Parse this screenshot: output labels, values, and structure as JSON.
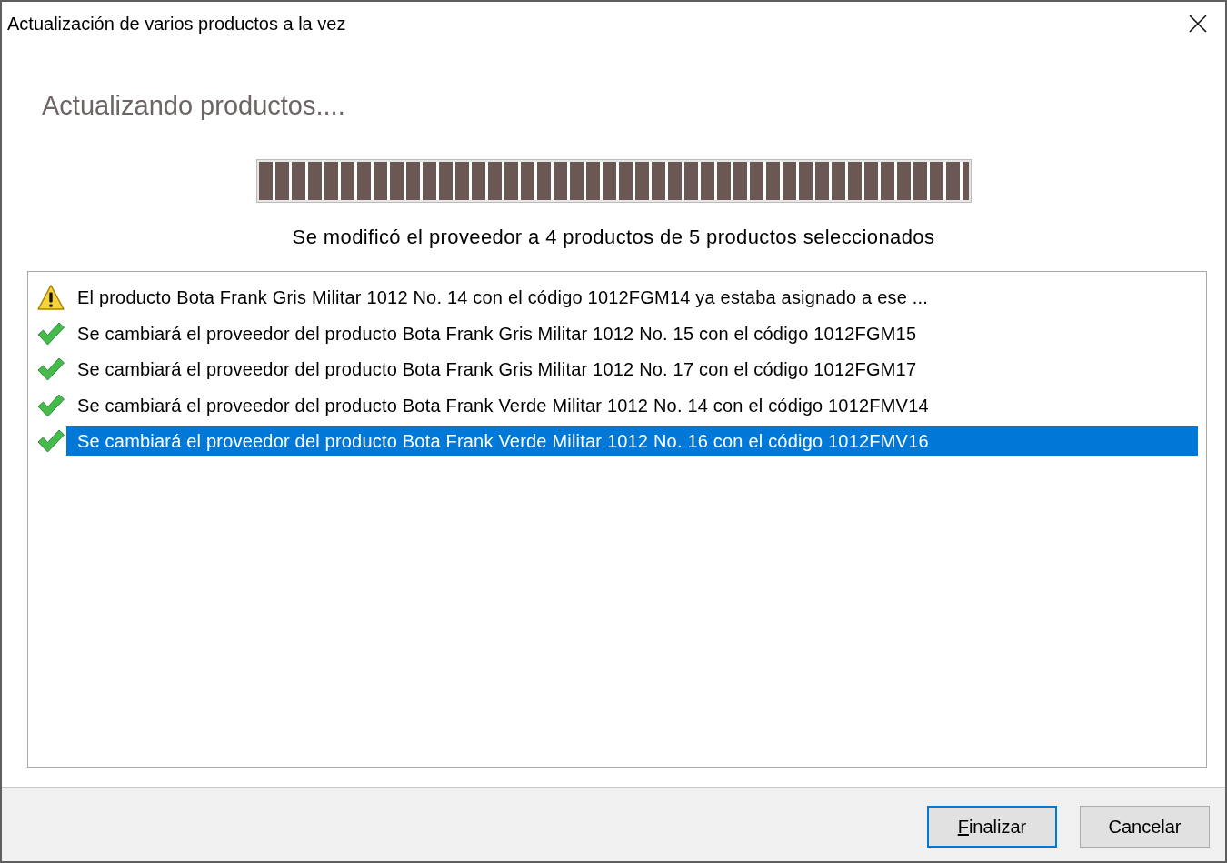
{
  "window": {
    "title": "Actualización de varios productos a la vez"
  },
  "heading": "Actualizando productos....",
  "progress": {
    "level": 1
  },
  "status": "Se modificó el proveedor a 4 productos de 5 productos seleccionados",
  "log": [
    {
      "kind": "warning",
      "text": "El producto Bota Frank Gris Militar 1012 No. 14 con el código 1012FGM14 ya estaba asignado a ese ...",
      "selected": false
    },
    {
      "kind": "success",
      "text": "Se cambiará el proveedor del producto Bota Frank Gris Militar 1012 No. 15 con el código 1012FGM15",
      "selected": false
    },
    {
      "kind": "success",
      "text": "Se cambiará el proveedor del producto Bota Frank Gris Militar 1012 No. 17 con el código 1012FGM17",
      "selected": false
    },
    {
      "kind": "success",
      "text": "Se cambiará el proveedor del producto Bota Frank Verde Militar 1012 No. 14 con el código 1012FMV14",
      "selected": false
    },
    {
      "kind": "success",
      "text": "Se cambiará el proveedor del producto Bota Frank Verde Militar 1012 No. 16 con el código 1012FMV16",
      "selected": true
    }
  ],
  "buttons": [
    {
      "label": "Finalizar",
      "default": true,
      "mnemonic_underlined": true
    },
    {
      "label": "Cancelar",
      "default": false,
      "mnemonic_underlined": false
    }
  ]
}
